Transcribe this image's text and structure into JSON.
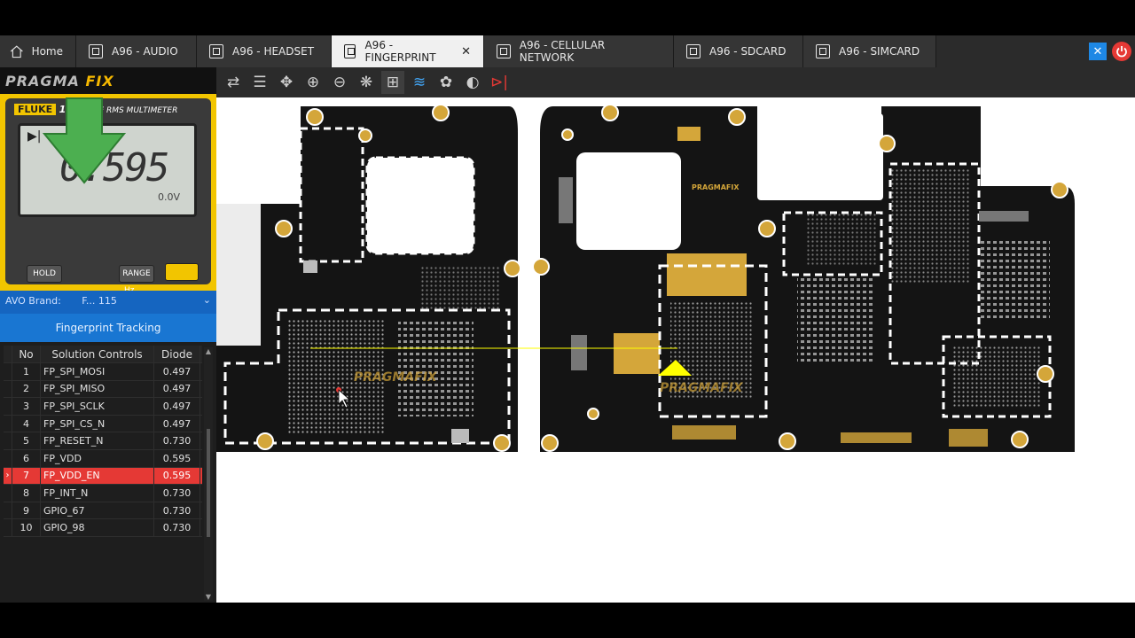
{
  "tabs": [
    {
      "label": "Home",
      "icon": "home-icon"
    },
    {
      "label": "A96 - AUDIO",
      "icon": "schematic-icon"
    },
    {
      "label": "A96 - HEADSET",
      "icon": "schematic-icon"
    },
    {
      "label": "A96 - FINGERPRINT",
      "icon": "schematic-icon",
      "active": true
    },
    {
      "label": "A96 - CELLULAR NETWORK",
      "icon": "schematic-icon"
    },
    {
      "label": "A96 - SDCARD",
      "icon": "schematic-icon"
    },
    {
      "label": "A96 - SIMCARD",
      "icon": "schematic-icon"
    }
  ],
  "toolbar": {
    "icons": [
      "swap-icon",
      "menu-icon",
      "move-icon",
      "zoom-in-icon",
      "zoom-out-icon",
      "network-icon",
      "tree-icon",
      "layers-icon",
      "palette-icon",
      "contrast-icon",
      "diode-icon"
    ]
  },
  "logo": {
    "part1": "PRAGMA",
    "part2": "FIX"
  },
  "meter": {
    "brand": "FLUKE",
    "model": "115",
    "subtitle": "TRUE RMS MULTIMETER",
    "reading": "0.595",
    "unit": "0.0V",
    "hold": "HOLD",
    "range": "RANGE",
    "hz": "Hz"
  },
  "avo": {
    "label": "AVO Brand:",
    "value": "F... 115"
  },
  "tracking": "Fingerprint Tracking",
  "table": {
    "headers": [
      "No",
      "Solution Controls",
      "Diode"
    ],
    "rows": [
      {
        "no": "1",
        "name": "FP_SPI_MOSI",
        "diode": "0.497"
      },
      {
        "no": "2",
        "name": "FP_SPI_MISO",
        "diode": "0.497"
      },
      {
        "no": "3",
        "name": "FP_SPI_SCLK",
        "diode": "0.497"
      },
      {
        "no": "4",
        "name": "FP_SPI_CS_N",
        "diode": "0.497"
      },
      {
        "no": "5",
        "name": "FP_RESET_N",
        "diode": "0.730"
      },
      {
        "no": "6",
        "name": "FP_VDD",
        "diode": "0.595"
      },
      {
        "no": "7",
        "name": "FP_VDD_EN",
        "diode": "0.595",
        "selected": true
      },
      {
        "no": "8",
        "name": "FP_INT_N",
        "diode": "0.730"
      },
      {
        "no": "9",
        "name": "GPIO_67",
        "diode": "0.730"
      },
      {
        "no": "10",
        "name": "GPIO_98",
        "diode": "0.730"
      }
    ]
  },
  "board": {
    "watermark": "PRAGMAFIX",
    "logo_small": "PRAGMAFIX"
  },
  "colors": {
    "accent": "#1976d2",
    "selected": "#e53935",
    "board": "#141414",
    "gold": "#d4a63a",
    "trace": "#ffff00"
  }
}
